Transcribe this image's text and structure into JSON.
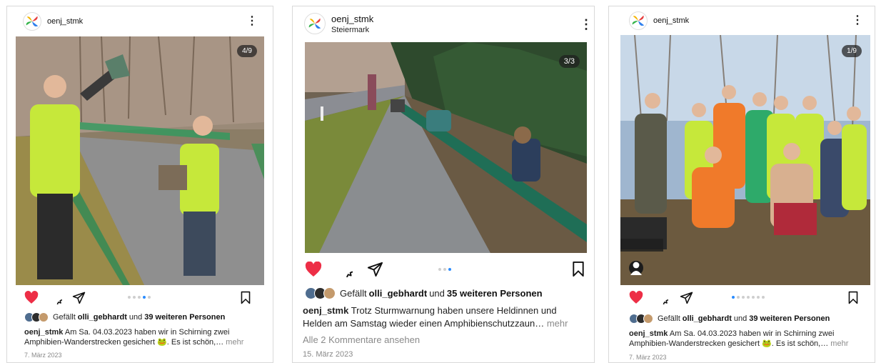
{
  "posts": [
    {
      "username": "oenj_stmk",
      "location": "",
      "counter": "4/9",
      "liked_by_prefix": "Gefällt",
      "liked_by_user": "olli_gebhardt",
      "liked_by_middle": "und",
      "liked_by_others": "39 weiteren Personen",
      "caption_user": "oenj_stmk",
      "caption_text": "Am Sa. 04.03.2023 haben wir in Schirning  zwei Amphibien-Wanderstrecken gesichert 🐸. Es ist schön,…",
      "more": "mehr",
      "comments": "",
      "date": "7. März 2023",
      "liked": true,
      "carousel_total": 5,
      "carousel_active": 3
    },
    {
      "username": "oenj_stmk",
      "location": "Steiermark",
      "counter": "3/3",
      "liked_by_prefix": "Gefällt",
      "liked_by_user": "olli_gebhardt",
      "liked_by_middle": "und",
      "liked_by_others": "35 weiteren Personen",
      "caption_user": "oenj_stmk",
      "caption_text": "Trotz Sturmwarnung haben unsere Heldinnen und Helden am Samstag wieder einen Amphibienschutzzaun…",
      "more": "mehr",
      "comments": "Alle 2 Kommentare ansehen",
      "date": "15. März 2023",
      "liked": true,
      "carousel_total": 3,
      "carousel_active": 3
    },
    {
      "username": "oenj_stmk",
      "location": "",
      "counter": "1/9",
      "liked_by_prefix": "Gefällt",
      "liked_by_user": "olli_gebhardt",
      "liked_by_middle": "und",
      "liked_by_others": "39 weiteren Personen",
      "caption_user": "oenj_stmk",
      "caption_text": "Am Sa. 04.03.2023 haben wir in Schirning  zwei Amphibien-Wanderstrecken gesichert 🐸. Es ist schön,…",
      "more": "mehr",
      "comments": "",
      "date": "7. März 2023",
      "liked": true,
      "carousel_total": 7,
      "carousel_active": 1
    }
  ],
  "colors": {
    "like_red": "#ed2e46",
    "dot_active": "#2a8cff",
    "muted_text": "#8a8a8a"
  }
}
